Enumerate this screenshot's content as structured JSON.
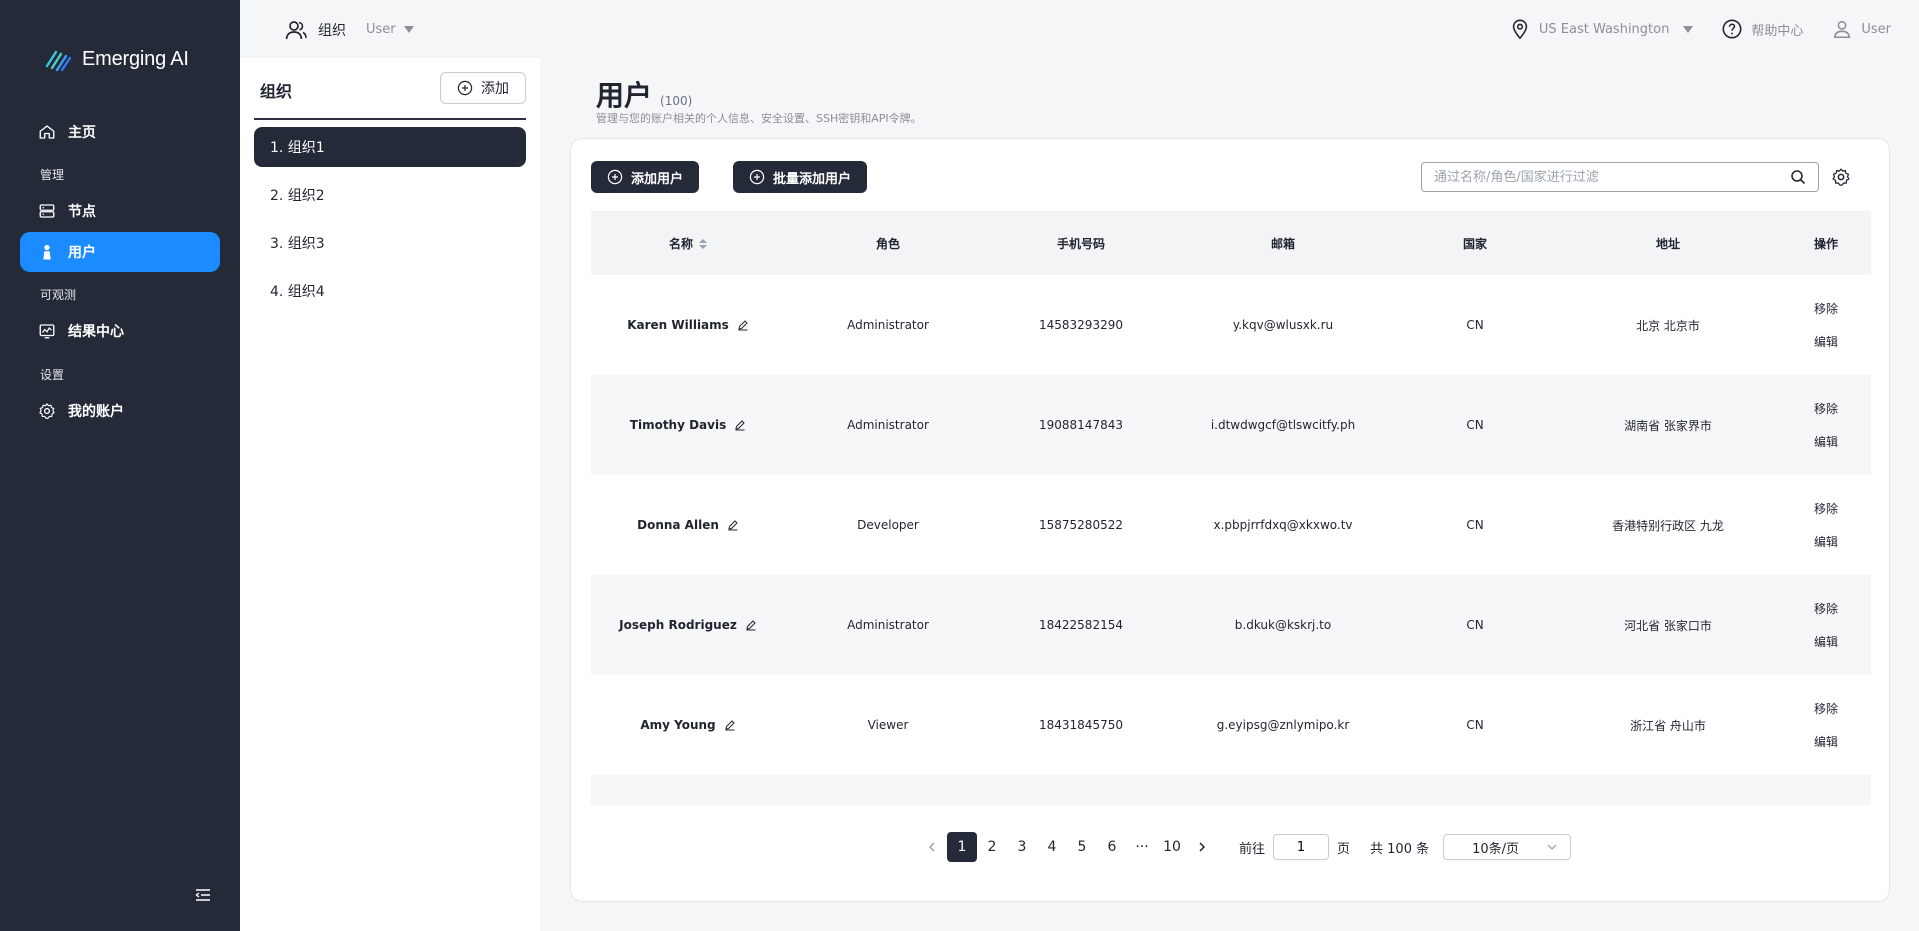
{
  "brand": {
    "name": "Emerging AI"
  },
  "sidebar": {
    "items": [
      {
        "label": "主页",
        "icon": "home-icon"
      },
      {
        "label": "节点",
        "icon": "server-icon"
      },
      {
        "label": "用户",
        "icon": "user-icon"
      },
      {
        "label": "结果中心",
        "icon": "monitor-chart-icon"
      },
      {
        "label": "我的账户",
        "icon": "gear-icon"
      }
    ],
    "sections": [
      "管理",
      "可观测",
      "设置"
    ],
    "active": "用户"
  },
  "topbar": {
    "org_label": "组织",
    "role_label": "User",
    "region": "US East Washington",
    "help": "帮助中心",
    "user": "User"
  },
  "orgs": {
    "title": "组织",
    "add_label": "添加",
    "items": [
      "1. 组织1",
      "2. 组织2",
      "3. 组织3",
      "4. 组织4"
    ],
    "active_index": 0
  },
  "page": {
    "title": "用户",
    "count": "(100)",
    "description": "管理与您的账户相关的个人信息、安全设置、SSH密钥和API令牌。"
  },
  "toolbar": {
    "add_user": "添加用户",
    "bulk_add": "批量添加用户",
    "search_placeholder": "通过名称/角色/国家进行过滤"
  },
  "table": {
    "headers": [
      "名称",
      "角色",
      "手机号码",
      "邮箱",
      "国家",
      "地址",
      "操作"
    ],
    "rows": [
      {
        "name": "Karen Williams",
        "role": "Administrator",
        "phone": "14583293290",
        "email": "y.kqv@wlusxk.ru",
        "country": "CN",
        "address": "北京 北京市"
      },
      {
        "name": "Timothy Davis",
        "role": "Administrator",
        "phone": "19088147843",
        "email": "i.dtwdwgcf@tlswcitfy.ph",
        "country": "CN",
        "address": "湖南省 张家界市"
      },
      {
        "name": "Donna Allen",
        "role": "Developer",
        "phone": "15875280522",
        "email": "x.pbpjrrfdxq@xkxwo.tv",
        "country": "CN",
        "address": "香港特别行政区 九龙"
      },
      {
        "name": "Joseph Rodriguez",
        "role": "Administrator",
        "phone": "18422582154",
        "email": "b.dkuk@kskrj.to",
        "country": "CN",
        "address": "河北省 张家口市"
      },
      {
        "name": "Amy Young",
        "role": "Viewer",
        "phone": "18431845750",
        "email": "g.eyipsg@znlymipo.kr",
        "country": "CN",
        "address": "浙江省 舟山市"
      }
    ],
    "action_remove": "移除",
    "action_edit": "编辑"
  },
  "pagination": {
    "pages": [
      "1",
      "2",
      "3",
      "4",
      "5",
      "6",
      "···",
      "10"
    ],
    "current": "1",
    "goto_label": "前往",
    "goto_value": "1",
    "page_suffix": "页",
    "total": "共 100 条",
    "page_size": "10条/页"
  }
}
